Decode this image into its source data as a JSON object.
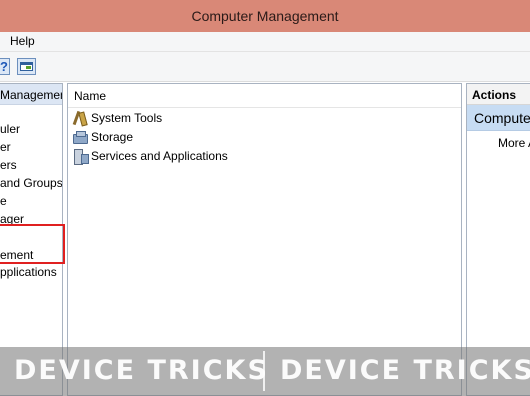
{
  "window": {
    "title": "Computer Management"
  },
  "menu": {
    "help": "Help"
  },
  "toolbar": {
    "help_glyph": "?"
  },
  "tree": {
    "header": "Management (Local",
    "items": [
      "uler",
      "er",
      "ers",
      "and Groups",
      "e",
      "ager",
      "ement",
      "pplications"
    ]
  },
  "list": {
    "column_name": "Name",
    "items": [
      {
        "label": "System Tools",
        "icon": "system-tools-icon"
      },
      {
        "label": "Storage",
        "icon": "storage-icon"
      },
      {
        "label": "Services and Applications",
        "icon": "services-icon"
      }
    ]
  },
  "actions": {
    "header": "Actions",
    "group": "Compute",
    "more": "More A"
  },
  "watermark": {
    "left": "DEVICE TRICKS",
    "right": "DEVICE TRICKS"
  },
  "colors": {
    "titlebar": "#d98877",
    "highlight": "#e02020",
    "actions_group": "#c7dcf3"
  }
}
